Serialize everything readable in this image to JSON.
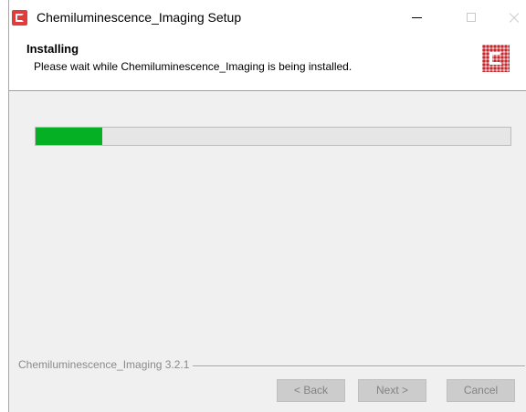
{
  "window": {
    "title": "Chemiluminescence_Imaging Setup"
  },
  "icons": {
    "app": "installer-app-icon",
    "header_logo": "brand-logo-icon",
    "minimize": "minimize-icon",
    "maximize": "maximize-icon",
    "close": "close-icon"
  },
  "header": {
    "title": "Installing",
    "subtitle": "Please wait while Chemiluminescence_Imaging is being installed."
  },
  "progress": {
    "percent": 14,
    "fill_color": "#06b025"
  },
  "footer": {
    "brand_version": "Chemiluminescence_Imaging 3.2.1"
  },
  "buttons": {
    "back": "< Back",
    "next": "Next >",
    "cancel": "Cancel"
  },
  "colors": {
    "accent_red": "#e03c3c",
    "progress_green": "#06b025"
  }
}
